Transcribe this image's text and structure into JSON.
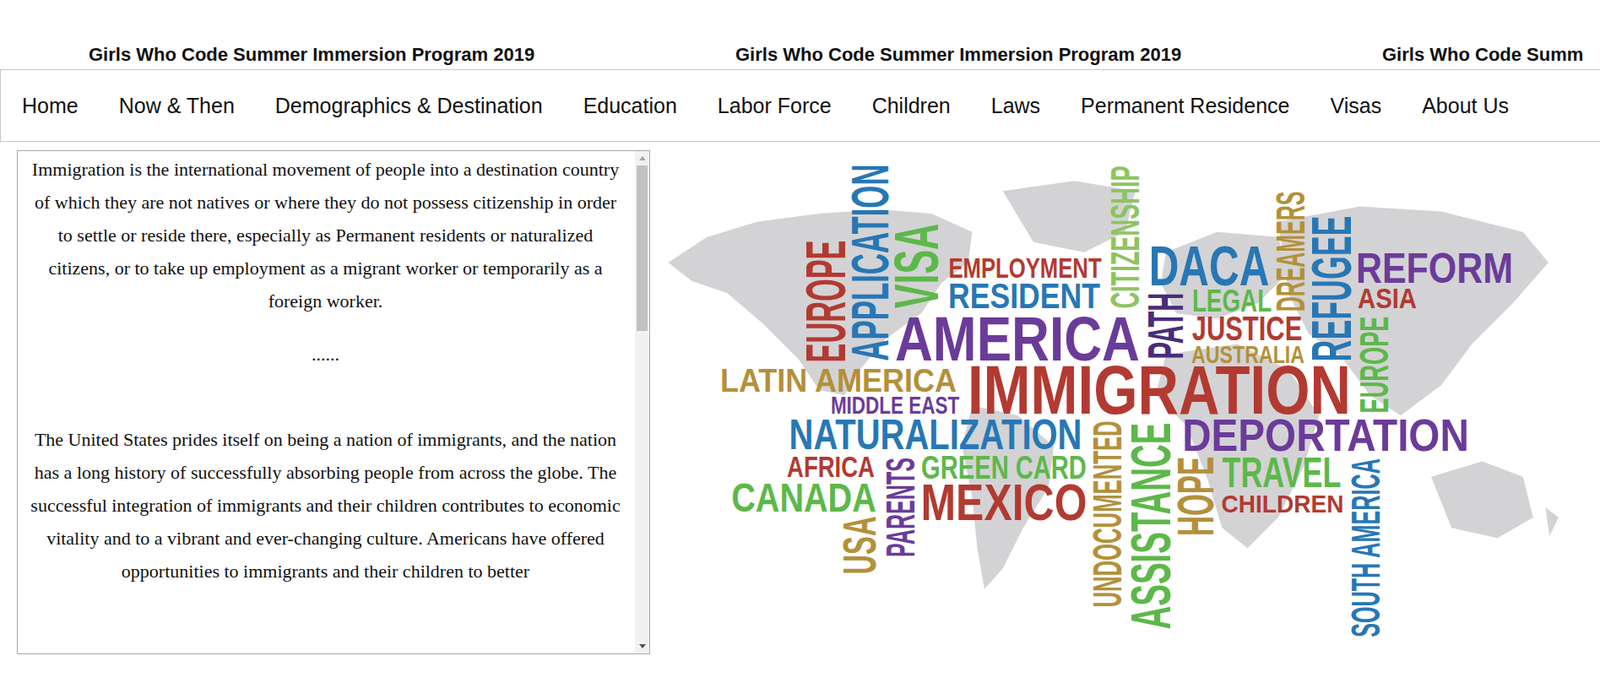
{
  "banner": {
    "items": [
      "Girls Who Code Summer Immersion Program 2019",
      "Girls Who Code Summer Immersion Program 2019",
      "Girls Who Code Summ"
    ]
  },
  "nav": {
    "items": [
      {
        "label": "Home"
      },
      {
        "label": "Now & Then"
      },
      {
        "label": "Demographics & Destination"
      },
      {
        "label": "Education"
      },
      {
        "label": "Labor Force"
      },
      {
        "label": "Children"
      },
      {
        "label": "Laws"
      },
      {
        "label": "Permanent Residence"
      },
      {
        "label": "Visas"
      },
      {
        "label": "About Us"
      }
    ]
  },
  "intro": {
    "paragraphs": [
      "Immigration is the international movement of people into a destination country of which they are not natives or where they do not possess citizenship in order to settle or reside there, especially as Permanent residents or naturalized citizens, or to take up employment as a migrant worker or temporarily as a foreign worker.",
      "......",
      "The United States prides itself on being a nation of immigrants, and the nation has a long history of successfully absorbing people from across the globe. The successful integration of immigrants and their children contributes to economic vitality and to a vibrant and ever-changing culture. Americans have offered opportunities to immigrants and their children to better"
    ],
    "scrollbar": {
      "level": 0.35
    }
  },
  "word_cloud": {
    "words": [
      {
        "text": "EUROPE",
        "color": "#b23a31",
        "kind": "vertical"
      },
      {
        "text": "APPLICATION",
        "color": "#2777b5",
        "kind": "vertical"
      },
      {
        "text": "VISA",
        "color": "#5db84a",
        "kind": "vertical"
      },
      {
        "text": "EMPLOYMENT",
        "color": "#b23a31",
        "kind": "horizontal"
      },
      {
        "text": "RESIDENT",
        "color": "#2777b5",
        "kind": "horizontal"
      },
      {
        "text": "CITIZENSHIP",
        "color": "#8cc560",
        "kind": "vertical"
      },
      {
        "text": "DACA",
        "color": "#2777b5",
        "kind": "horizontal"
      },
      {
        "text": "DREAMERS",
        "color": "#b3903a",
        "kind": "vertical"
      },
      {
        "text": "REFUGEE",
        "color": "#2777b5",
        "kind": "vertical"
      },
      {
        "text": "REFORM",
        "color": "#6b3b9a",
        "kind": "horizontal"
      },
      {
        "text": "ASIA",
        "color": "#b23a31",
        "kind": "horizontal"
      },
      {
        "text": "AMERICA",
        "color": "#6b3b9a",
        "kind": "horizontal"
      },
      {
        "text": "PATH",
        "color": "#4a2d7a",
        "kind": "vertical"
      },
      {
        "text": "LEGAL",
        "color": "#5db84a",
        "kind": "horizontal"
      },
      {
        "text": "JUSTICE",
        "color": "#b23a31",
        "kind": "horizontal"
      },
      {
        "text": "AUSTRALIA",
        "color": "#b3903a",
        "kind": "horizontal"
      },
      {
        "text": "EUROPE",
        "color": "#5db84a",
        "kind": "vertical"
      },
      {
        "text": "LATIN AMERICA",
        "color": "#b3903a",
        "kind": "horizontal"
      },
      {
        "text": "IMMIGRATION",
        "color": "#b23a31",
        "kind": "horizontal"
      },
      {
        "text": "MIDDLE EAST",
        "color": "#6b3b9a",
        "kind": "horizontal"
      },
      {
        "text": "NATURALIZATION",
        "color": "#2777b5",
        "kind": "horizontal"
      },
      {
        "text": "UNDOCUMENTED",
        "color": "#b3903a",
        "kind": "vertical"
      },
      {
        "text": "ASSISTANCE",
        "color": "#5db84a",
        "kind": "vertical"
      },
      {
        "text": "DEPORTATION",
        "color": "#6b3b9a",
        "kind": "horizontal"
      },
      {
        "text": "AFRICA",
        "color": "#b23a31",
        "kind": "horizontal"
      },
      {
        "text": "PARENTS",
        "color": "#6b3b9a",
        "kind": "vertical"
      },
      {
        "text": "GREEN CARD",
        "color": "#5db84a",
        "kind": "horizontal"
      },
      {
        "text": "HOPE",
        "color": "#b3903a",
        "kind": "vertical"
      },
      {
        "text": "TRAVEL",
        "color": "#5db84a",
        "kind": "horizontal"
      },
      {
        "text": "CANADA",
        "color": "#5db84a",
        "kind": "horizontal"
      },
      {
        "text": "MEXICO",
        "color": "#b23a31",
        "kind": "horizontal"
      },
      {
        "text": "CHILDREN",
        "color": "#b23a31",
        "kind": "horizontal"
      },
      {
        "text": "USA",
        "color": "#b3903a",
        "kind": "vertical"
      },
      {
        "text": "SOUTH AMERICA",
        "color": "#2777b5",
        "kind": "vertical"
      }
    ]
  }
}
